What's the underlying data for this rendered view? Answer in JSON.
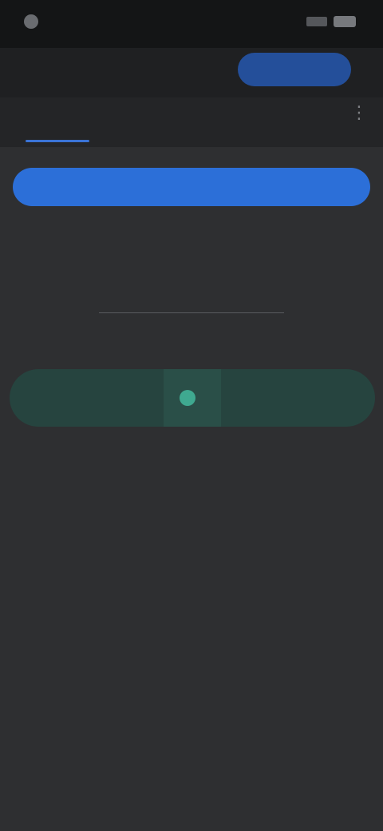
{
  "status_bar": {
    "time": "",
    "icons": [
      "app-icon",
      "signal-icon",
      "battery-icon"
    ]
  },
  "header": {
    "title": "",
    "action_label": ""
  },
  "tabs": [
    {
      "label": "",
      "active": true
    },
    {
      "label": "",
      "active": false
    },
    {
      "label": "",
      "active": false
    },
    {
      "label": "",
      "active": false
    }
  ],
  "more_icon": "more-icon",
  "primary_button": {
    "label": ""
  },
  "description": "",
  "link_text": "",
  "note_text": "",
  "teal_button": {
    "label": "",
    "icon": "status-dot-icon"
  },
  "colors": {
    "background": "#2e2f31",
    "primary": "#2c6fd8",
    "teal": "#26443f",
    "accent_tab": "#5b8fe2"
  }
}
